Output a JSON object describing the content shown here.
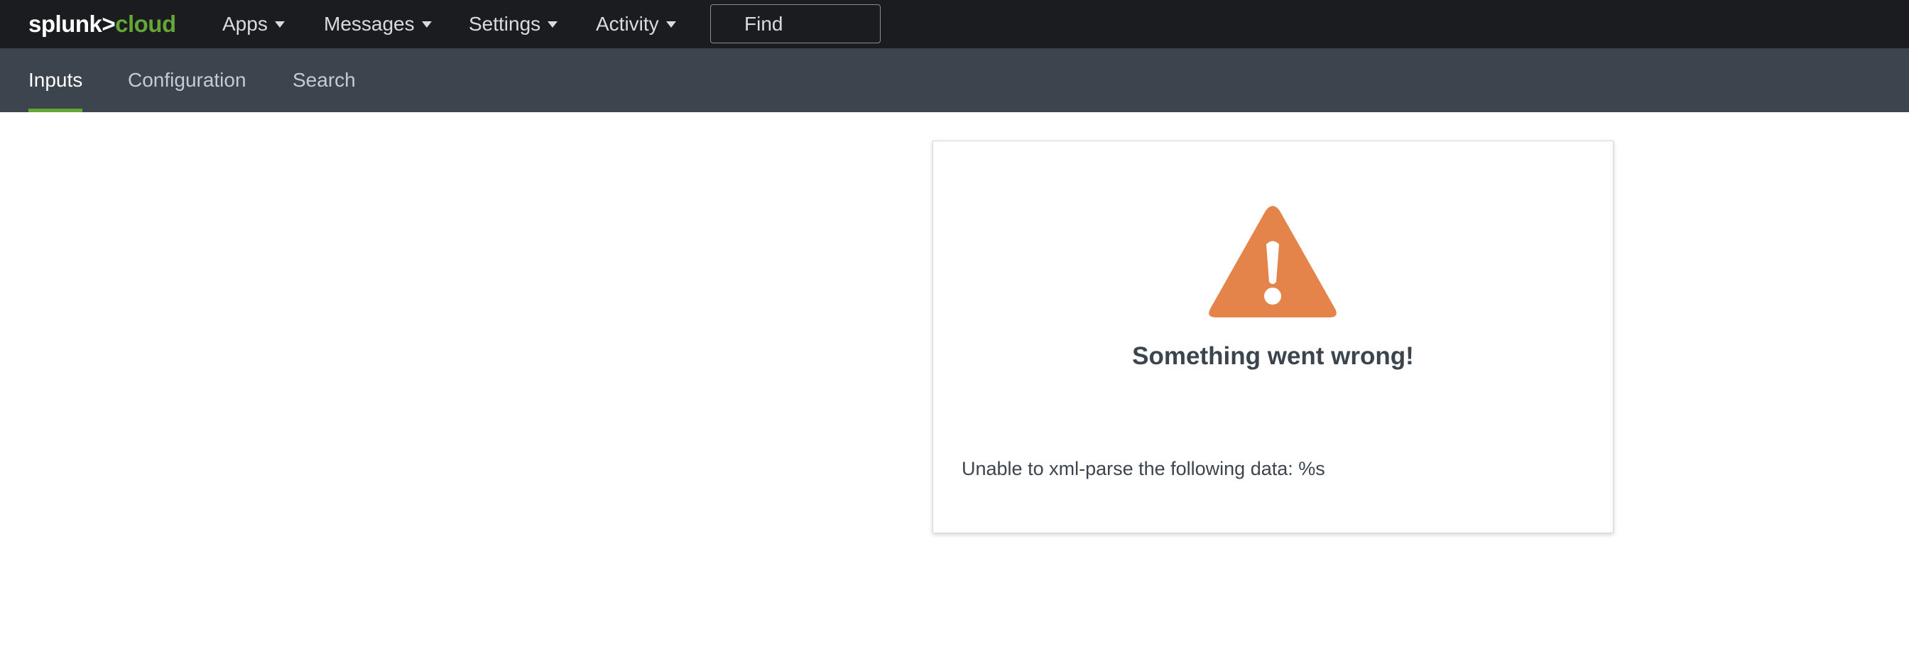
{
  "header": {
    "logo_main": "splunk>",
    "logo_suffix": "cloud",
    "menus": [
      {
        "label": "Apps"
      },
      {
        "label": "Messages"
      },
      {
        "label": "Settings"
      },
      {
        "label": "Activity"
      }
    ],
    "find_placeholder": "Find"
  },
  "app_nav": {
    "tabs": [
      {
        "label": "Inputs",
        "active": true
      },
      {
        "label": "Configuration",
        "active": false
      },
      {
        "label": "Search",
        "active": false
      }
    ]
  },
  "error_card": {
    "icon": "warning-triangle-icon",
    "title": "Something went wrong!",
    "message": "Unable to xml-parse the following data: %s"
  },
  "colors": {
    "topbar_bg": "#1a1c20",
    "appbar_bg": "#3c444d",
    "accent_green": "#65a637",
    "warning_orange": "#e4834a"
  }
}
